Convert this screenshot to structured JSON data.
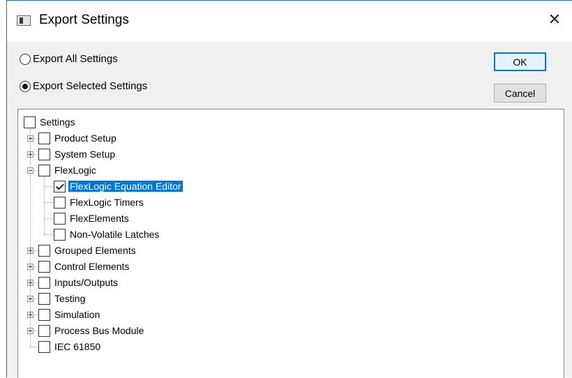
{
  "dialog": {
    "title": "Export Settings",
    "close_glyph": "✕"
  },
  "options": {
    "export_all": "Export All Settings",
    "export_selected": "Export Selected Settings",
    "selected": "export_selected"
  },
  "buttons": {
    "ok": "OK",
    "cancel": "Cancel"
  },
  "tree": {
    "root": {
      "label": "Settings",
      "checked": false
    },
    "items": [
      {
        "label": "Product Setup",
        "expander": "plus",
        "checked": false
      },
      {
        "label": "System Setup",
        "expander": "plus",
        "checked": false
      },
      {
        "label": "FlexLogic",
        "expander": "minus",
        "checked": false,
        "children": [
          {
            "label": "FlexLogic Equation Editor",
            "checked": true,
            "selected": true
          },
          {
            "label": "FlexLogic Timers",
            "checked": false
          },
          {
            "label": "FlexElements",
            "checked": false
          },
          {
            "label": "Non-Volatile Latches",
            "checked": false
          }
        ]
      },
      {
        "label": "Grouped Elements",
        "expander": "plus",
        "checked": false
      },
      {
        "label": "Control Elements",
        "expander": "plus",
        "checked": false
      },
      {
        "label": "Inputs/Outputs",
        "expander": "plus",
        "checked": false
      },
      {
        "label": "Testing",
        "expander": "plus",
        "checked": false
      },
      {
        "label": "Simulation",
        "expander": "plus",
        "checked": false
      },
      {
        "label": "Process Bus Module",
        "expander": "plus",
        "checked": false
      },
      {
        "label": "IEC 61850",
        "expander": "none",
        "checked": false
      }
    ]
  },
  "colors": {
    "accent": "#0078d7",
    "dialog_bg": "#f0f0f0"
  }
}
